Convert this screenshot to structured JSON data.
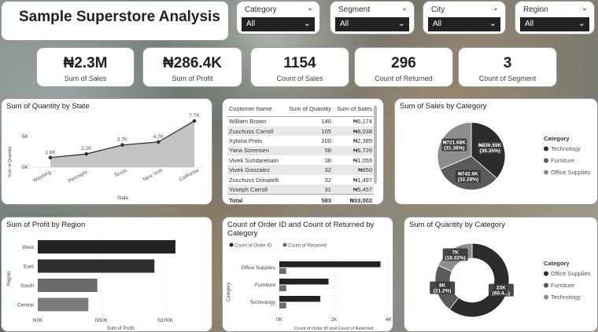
{
  "title": "Sample Superstore Analysis",
  "slicers": [
    {
      "label": "Category",
      "value": "All"
    },
    {
      "label": "Segment",
      "value": "All"
    },
    {
      "label": "City",
      "value": "All"
    },
    {
      "label": "Region",
      "value": "All"
    }
  ],
  "kpis": [
    {
      "value": "₦2.3M",
      "label": "Sum of Sales"
    },
    {
      "value": "₦286.4K",
      "label": "Sum of Profit"
    },
    {
      "value": "1154",
      "label": "Count of Sales"
    },
    {
      "value": "296",
      "label": "Count of Returned"
    },
    {
      "value": "3",
      "label": "Count of Segment"
    }
  ],
  "qty_state": {
    "title": "Sum of Quantity by State",
    "xlabel": "State",
    "ylabel": "Sum of Quantity",
    "yticks": [
      "5K",
      "0K"
    ],
    "points": [
      {
        "state": "Washing...",
        "value": 1600,
        "label": "1.6K"
      },
      {
        "state": "Pennsylv...",
        "value": 2200,
        "label": "2.2K"
      },
      {
        "state": "Texas",
        "value": 3700,
        "label": "3.7K"
      },
      {
        "state": "New York",
        "value": 4200,
        "label": "4.2K"
      },
      {
        "state": "California",
        "value": 7700,
        "label": "7.7K"
      }
    ]
  },
  "customer_table": {
    "headers": [
      "Customer Name",
      "Sum of Quantity",
      "Sum of Sales"
    ],
    "rows": [
      [
        "William Brown",
        "146",
        "₦6,174"
      ],
      [
        "Zuschuss Carroll",
        "105",
        "₦8,038"
      ],
      [
        "Xylona Preis",
        "100",
        "₦2,389"
      ],
      [
        "Yana Sorensen",
        "58",
        "₦6,726"
      ],
      [
        "Vivek Sundaresam",
        "38",
        "₦1,059"
      ],
      [
        "Vivek Gonzalez",
        "32",
        "₦850"
      ],
      [
        "Zuschuss Donatelli",
        "32",
        "₦1,497"
      ],
      [
        "Yoseph Carroll",
        "31",
        "₦5,457"
      ]
    ],
    "total": [
      "Total",
      "583",
      "₦33,002"
    ]
  },
  "sales_category": {
    "title": "Sum of Sales by Category",
    "legend_title": "Category",
    "slices": [
      {
        "name": "Technology",
        "value": 836590,
        "label": "₦836.59K",
        "pct": "(36.35%)",
        "color": "#2b2b2b"
      },
      {
        "name": "Furniture",
        "value": 742900,
        "label": "₦742.9K",
        "pct": "(32.28%)",
        "color": "#5a5a5a"
      },
      {
        "name": "Office Supplies",
        "value": 721680,
        "label": "₦721.68K",
        "pct": "(31.36%)",
        "color": "#8e8e8e"
      }
    ]
  },
  "profit_region": {
    "title": "Sum of Profit by Region",
    "xlabel": "Sum of Profit",
    "ylabel": "Region",
    "xticks": [
      "N0K",
      "N50K",
      "N100K"
    ],
    "bars": [
      {
        "name": "West",
        "value": 108000,
        "color": "#222222"
      },
      {
        "name": "East",
        "value": 91500,
        "color": "#2e2e2e"
      },
      {
        "name": "South",
        "value": 46750,
        "color": "#6a6a6a"
      },
      {
        "name": "Central",
        "value": 39700,
        "color": "#7a7a7a"
      }
    ]
  },
  "order_returned": {
    "title": "Count of Order ID and Count of Returned by Category",
    "legend": [
      "Count of Order ID",
      "Count of Returned"
    ],
    "xlabel": "Count of Order ID and Count of Returned",
    "ylabel": "Category",
    "xticks": [
      "0K",
      "2K",
      "4K"
    ],
    "categories": [
      "Office Supplies",
      "Furniture",
      "Technology"
    ],
    "series": [
      {
        "name": "Count of Order ID",
        "values": [
          3700,
          1800,
          1500
        ],
        "color": "#222222"
      },
      {
        "name": "Count of Returned",
        "values": [
          250,
          250,
          250
        ],
        "color": "#6a6a6a"
      }
    ]
  },
  "qty_category": {
    "title": "Sum of Quantity by Category",
    "legend_title": "Category",
    "slices": [
      {
        "name": "Office Supplies",
        "value": 23000,
        "label": "23K",
        "pct": "(60.4...)",
        "color": "#2b2b2b"
      },
      {
        "name": "Furniture",
        "value": 8000,
        "label": "8K",
        "pct": "(21.2%)",
        "color": "#5a5a5a"
      },
      {
        "name": "Technology",
        "value": 7000,
        "label": "7K",
        "pct": "(18.32%)",
        "color": "#8e8e8e"
      }
    ]
  },
  "chart_data": [
    {
      "type": "area",
      "title": "Sum of Quantity by State",
      "xlabel": "State",
      "ylabel": "Sum of Quantity",
      "categories": [
        "Washing...",
        "Pennsylv...",
        "Texas",
        "New York",
        "California"
      ],
      "values": [
        1600,
        2200,
        3700,
        4200,
        7700
      ]
    },
    {
      "type": "pie",
      "title": "Sum of Sales by Category",
      "categories": [
        "Technology",
        "Furniture",
        "Office Supplies"
      ],
      "values": [
        836590,
        742900,
        721680
      ]
    },
    {
      "type": "bar",
      "title": "Sum of Profit by Region",
      "xlabel": "Sum of Profit",
      "ylabel": "Region",
      "categories": [
        "West",
        "East",
        "South",
        "Central"
      ],
      "values": [
        108000,
        91500,
        46750,
        39700
      ]
    },
    {
      "type": "bar",
      "title": "Count of Order ID and Count of Returned by Category",
      "categories": [
        "Office Supplies",
        "Furniture",
        "Technology"
      ],
      "series": [
        {
          "name": "Count of Order ID",
          "values": [
            3700,
            1800,
            1500
          ]
        },
        {
          "name": "Count of Returned",
          "values": [
            250,
            250,
            250
          ]
        }
      ]
    },
    {
      "type": "pie",
      "title": "Sum of Quantity by Category",
      "categories": [
        "Office Supplies",
        "Furniture",
        "Technology"
      ],
      "values": [
        23000,
        8000,
        7000
      ]
    }
  ]
}
